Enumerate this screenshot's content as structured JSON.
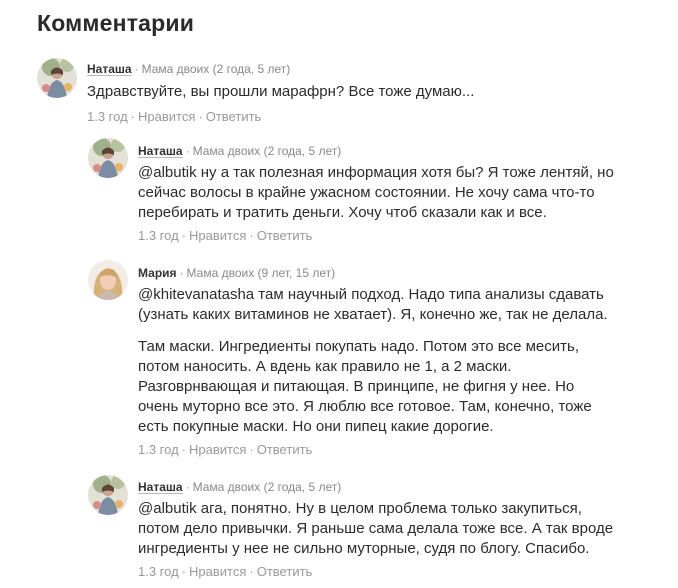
{
  "section": {
    "title": "Комментарии"
  },
  "comments": [
    {
      "author": "Наташа",
      "subtitle": "Мама двоих (2 года, 5 лет)",
      "avatar": "natasha-avatar-photo",
      "paragraphs": [
        "Здравствуйте, вы прошли марафрн? Все тоже думаю..."
      ],
      "time": "1.3 год",
      "like": "Нравится",
      "reply": "Ответить"
    },
    {
      "author": "Наташа",
      "subtitle": "Мама двоих (2 года, 5 лет)",
      "avatar": "natasha-avatar-photo",
      "paragraphs": [
        "@albutik ну а так полезная информация хотя бы? Я тоже лентяй, но сейчас волосы в крайне ужасном состоянии. Не хочу сама что-то перебирать и тратить деньги. Хочу чтоб сказали как и все."
      ],
      "time": "1.3 год",
      "like": "Нравится",
      "reply": "Ответить"
    },
    {
      "author": "Мария",
      "subtitle": "Мама двоих (9 лет, 15 лет)",
      "avatar": "maria-avatar-photo",
      "paragraphs": [
        "@khitevanatasha там научный подход. Надо типа анализы сдавать (узнать каких витаминов не хватает). Я, конечно же, так не делала.",
        "Там маски. Ингредиенты покупать надо. Потом это все месить, потом наносить. А вдень как правило не 1, а 2 маски. Разговрнвающая и питающая. В принципе, не фигня у нее. Но очень муторно все это. Я люблю все готовое. Там, конечно, тоже есть покупные маски. Но они пипец какие дорогие."
      ],
      "time": "1.3 год",
      "like": "Нравится",
      "reply": "Ответить"
    },
    {
      "author": "Наташа",
      "subtitle": "Мама двоих (2 года, 5 лет)",
      "avatar": "natasha-avatar-photo",
      "paragraphs": [
        "@albutik ага, понятно. Ну в целом проблема только закупиться, потом дело привычки. Я раньше сама делала тоже все. А так вроде ингредиенты у нее не сильно муторные, судя по блогу. Спасибо."
      ],
      "time": "1.3 год",
      "like": "Нравится",
      "reply": "Ответить"
    }
  ]
}
